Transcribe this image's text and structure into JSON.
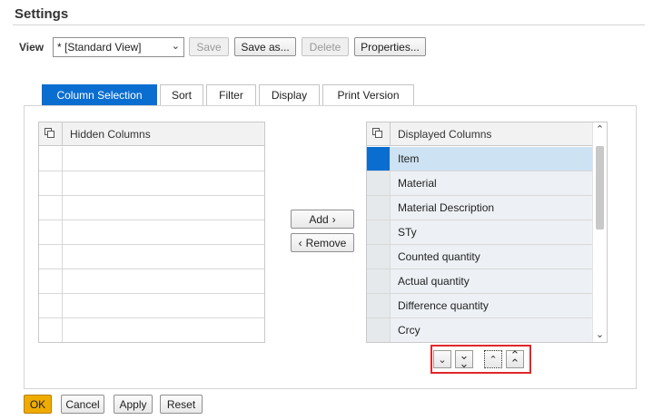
{
  "dialog": {
    "title": "Settings"
  },
  "view": {
    "label": "View",
    "selected": "* [Standard View]",
    "buttons": {
      "save": "Save",
      "save_as": "Save as...",
      "delete": "Delete",
      "properties": "Properties..."
    }
  },
  "tabs": [
    {
      "label": "Column Selection",
      "active": true
    },
    {
      "label": "Sort"
    },
    {
      "label": "Filter"
    },
    {
      "label": "Display"
    },
    {
      "label": "Print Version"
    }
  ],
  "hidden_columns": {
    "header": "Hidden Columns",
    "rows": [
      "",
      "",
      "",
      "",
      "",
      "",
      "",
      ""
    ]
  },
  "transfer": {
    "add": "Add",
    "remove": "Remove"
  },
  "displayed_columns": {
    "header": "Displayed Columns",
    "rows": [
      "Item",
      "Material",
      "Material Description",
      "STy",
      "Counted quantity",
      "Actual quantity",
      "Difference quantity",
      "Crcy"
    ],
    "selected_index": 0
  },
  "footer": {
    "ok": "OK",
    "cancel": "Cancel",
    "apply": "Apply",
    "reset": "Reset"
  },
  "colors": {
    "accent": "#0a6ed1",
    "primary_button": "#f0ab00",
    "highlight_box": "#e0272b"
  }
}
